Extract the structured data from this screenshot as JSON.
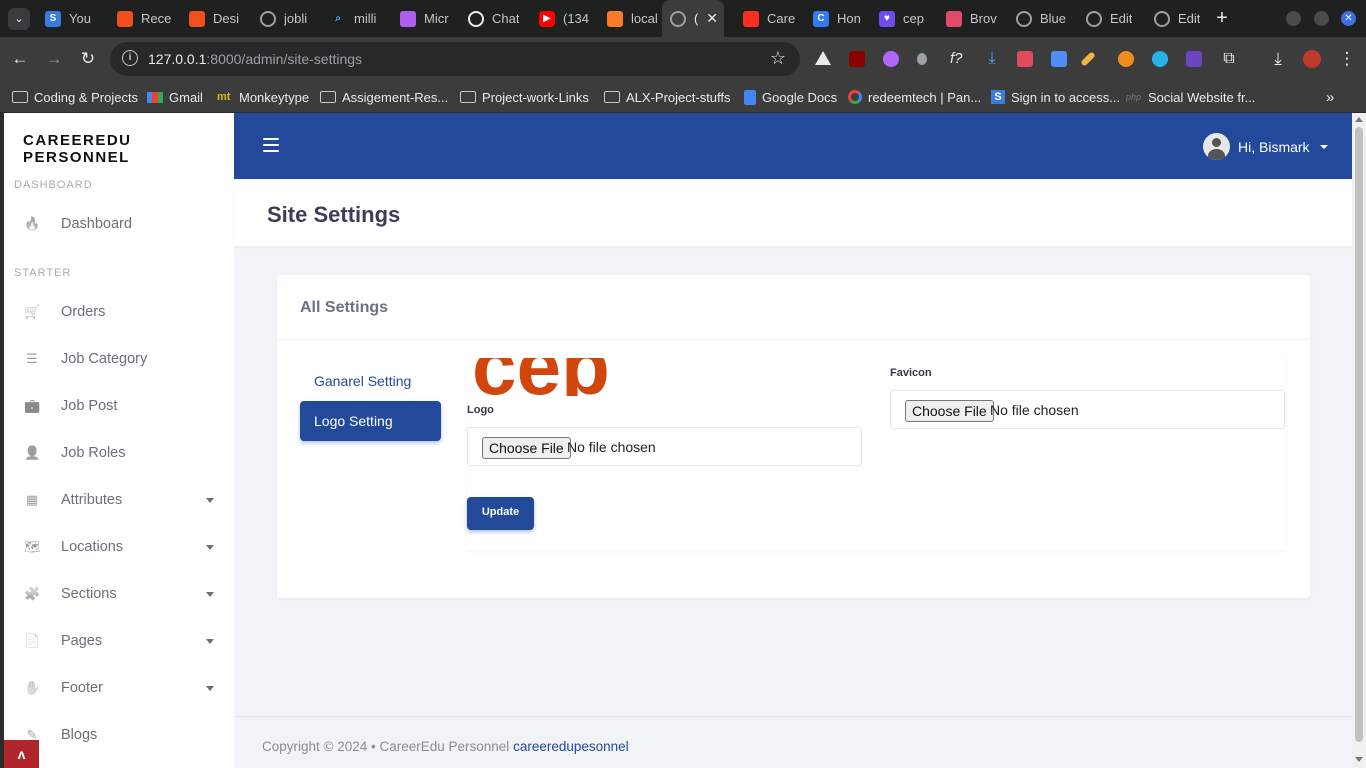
{
  "browser": {
    "tabs": [
      {
        "title": "You",
        "icon": "S"
      },
      {
        "title": "Rece",
        "icon": "figma"
      },
      {
        "title": "Desi",
        "icon": "figma"
      },
      {
        "title": "jobli",
        "icon": "globe"
      },
      {
        "title": "milli",
        "icon": "search"
      },
      {
        "title": "Micr",
        "icon": "copilot"
      },
      {
        "title": "Chat",
        "icon": "chatgpt"
      },
      {
        "title": "(134",
        "icon": "youtube"
      },
      {
        "title": "local",
        "icon": "xampp"
      },
      {
        "title": "(",
        "icon": "globe"
      },
      {
        "title": "Care",
        "icon": "laravel"
      },
      {
        "title": "Hon",
        "icon": "C"
      },
      {
        "title": "cep",
        "icon": "heart"
      },
      {
        "title": "Brov",
        "icon": "browserstack"
      },
      {
        "title": "Blue",
        "icon": "globe"
      },
      {
        "title": "Edit",
        "icon": "globe"
      },
      {
        "title": "Edit",
        "icon": "globe"
      }
    ],
    "url_host": "127.0.0.1",
    "url_rest": ":8000/admin/site-settings",
    "bookmarks": [
      "Coding & Projects",
      "Gmail",
      "Monkeytype",
      "Assigement-Res...",
      "Project-work-Links",
      "ALX-Project-stuffs",
      "Google Docs",
      "redeemtech | Pan...",
      "Sign in to access...",
      "Social Website fr..."
    ]
  },
  "sidebar": {
    "brand": "CAREEREDU PERSONNEL",
    "section_dashboard": "DASHBOARD",
    "section_starter": "STARTER",
    "items": [
      {
        "label": "Dashboard",
        "icon": "fire-icon"
      },
      {
        "label": "Orders",
        "icon": "cart-icon"
      },
      {
        "label": "Job Category",
        "icon": "list-icon"
      },
      {
        "label": "Job Post",
        "icon": "briefcase-icon"
      },
      {
        "label": "Job Roles",
        "icon": "user-icon"
      },
      {
        "label": "Attributes",
        "icon": "table-icon"
      },
      {
        "label": "Locations",
        "icon": "map-icon"
      },
      {
        "label": "Sections",
        "icon": "puzzle-icon"
      },
      {
        "label": "Pages",
        "icon": "file-icon"
      },
      {
        "label": "Footer",
        "icon": "hand-icon"
      },
      {
        "label": "Blogs",
        "icon": "blog-icon"
      }
    ]
  },
  "topnav": {
    "greeting": "Hi, Bismark"
  },
  "page": {
    "title": "Site Settings"
  },
  "settings": {
    "card_title": "All Settings",
    "tabs": [
      "Ganarel Setting",
      "Logo Setting"
    ],
    "active_tab": "Logo Setting",
    "logo_preview_text": "cep",
    "logo_label": "Logo",
    "favicon_label": "Favicon",
    "choose_file": "Choose File",
    "no_file": "No file chosen",
    "update_button": "Update"
  },
  "footer": {
    "copyright": "Copyright © 2024  •  CareerEdu Personnel",
    "link": "careeredupesonnel"
  },
  "colors": {
    "primary": "#234a9a",
    "logo_orange": "#d2450c"
  }
}
